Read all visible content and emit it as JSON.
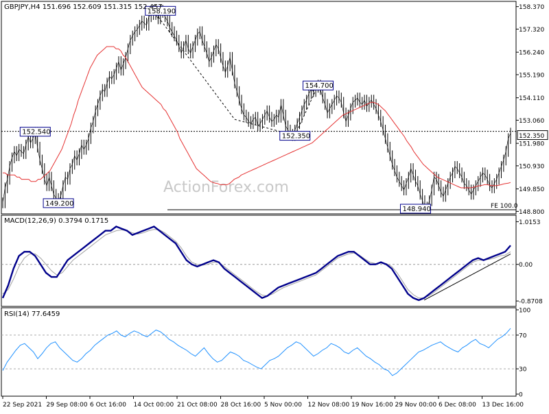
{
  "chart_data": [
    {
      "type": "line",
      "panel": "price",
      "title": "GBPJPY,H4  151.696 152.609 151.315 152.457",
      "watermark": "ActionForex.com",
      "ylim": [
        148.78,
        158.52
      ],
      "yticks": [
        "158.370",
        "157.320",
        "156.240",
        "155.190",
        "154.110",
        "153.060",
        "151.980",
        "150.930",
        "149.850",
        "148.800"
      ],
      "current_price_label": "152.350",
      "horizontal_levels": [
        {
          "name": "resistance-152.54",
          "value": 152.54
        },
        {
          "name": "fe-100",
          "value": 148.94,
          "label": "FE 100.0"
        }
      ],
      "annotations": [
        {
          "text": "158.190",
          "xi": 68,
          "y": 158.19
        },
        {
          "text": "152.540",
          "xi": 14,
          "y": 152.54
        },
        {
          "text": "149.200",
          "xi": 24,
          "y": 149.2
        },
        {
          "text": "154.700",
          "xi": 136,
          "y": 154.7
        },
        {
          "text": "152.350",
          "xi": 126,
          "y": 152.35
        },
        {
          "text": "148.940",
          "xi": 178,
          "y": 148.94
        }
      ],
      "series": [
        {
          "name": "GBPJPY",
          "color": "#000000",
          "values": [
            149.2,
            149.9,
            150.3,
            150.9,
            151.3,
            151.6,
            151.4,
            151.7,
            151.6,
            151.5,
            151.9,
            152.3,
            152.0,
            152.2,
            152.5,
            151.8,
            151.2,
            150.8,
            150.3,
            150.0,
            150.4,
            150.0,
            149.6,
            149.4,
            149.3,
            149.5,
            150.0,
            150.4,
            150.3,
            150.8,
            151.0,
            151.4,
            151.2,
            151.5,
            151.9,
            151.7,
            151.9,
            152.2,
            152.7,
            153.0,
            153.5,
            153.8,
            154.2,
            154.5,
            154.4,
            154.8,
            155.1,
            155.0,
            155.2,
            155.5,
            155.8,
            155.4,
            155.7,
            156.0,
            156.4,
            156.8,
            157.0,
            157.2,
            157.3,
            157.5,
            157.7,
            157.6,
            157.5,
            157.9,
            158.0,
            158.2,
            158.0,
            157.8,
            158.2,
            158.1,
            157.9,
            157.7,
            157.4,
            157.2,
            157.0,
            156.8,
            156.5,
            156.2,
            156.5,
            156.8,
            156.4,
            156.2,
            156.5,
            156.8,
            157.1,
            157.2,
            156.8,
            156.5,
            156.2,
            155.8,
            156.0,
            156.3,
            156.6,
            156.4,
            156.0,
            155.6,
            155.3,
            155.6,
            156.0,
            155.4,
            154.8,
            154.4,
            154.0,
            153.6,
            153.3,
            153.2,
            153.0,
            152.9,
            153.1,
            153.2,
            152.8,
            152.9,
            153.1,
            153.3,
            153.5,
            153.2,
            153.0,
            153.1,
            153.3,
            153.2,
            153.8,
            153.3,
            152.8,
            152.6,
            152.4,
            152.35,
            152.6,
            152.9,
            153.2,
            153.5,
            153.8,
            154.0,
            154.3,
            154.5,
            154.4,
            154.6,
            154.7,
            154.5,
            154.1,
            153.8,
            153.4,
            153.6,
            153.8,
            154.0,
            154.2,
            154.1,
            153.9,
            153.4,
            153.0,
            153.3,
            153.6,
            153.9,
            154.0,
            154.1,
            153.9,
            153.8,
            154.0,
            153.7,
            153.9,
            154.0,
            153.8,
            153.6,
            153.3,
            153.0,
            152.6,
            152.2,
            151.8,
            151.4,
            151.0,
            150.7,
            150.4,
            150.2,
            150.0,
            149.8,
            150.1,
            150.4,
            150.8,
            150.5,
            150.2,
            150.0,
            149.6,
            149.3,
            149.0,
            148.94,
            149.3,
            149.8,
            150.4,
            150.3,
            150.0,
            149.7,
            149.5,
            149.8,
            150.1,
            150.4,
            150.6,
            150.9,
            150.8,
            150.6,
            150.4,
            150.1,
            150.0,
            149.8,
            149.6,
            149.8,
            150.0,
            150.2,
            150.4,
            150.6,
            150.5,
            150.3,
            150.0,
            149.9,
            150.1,
            150.3,
            150.6,
            150.9,
            151.2,
            151.6,
            152.2,
            152.457
          ]
        },
        {
          "name": "MA",
          "color": "#e53030",
          "values": [
            150.6,
            150.6,
            150.5,
            150.5,
            150.5,
            150.5,
            150.4,
            150.4,
            150.3,
            150.3,
            150.3,
            150.3,
            150.2,
            150.2,
            150.2,
            150.3,
            150.3,
            150.4,
            150.5,
            150.6,
            150.7,
            150.9,
            151.1,
            151.3,
            151.5,
            151.7,
            152.0,
            152.3,
            152.6,
            152.9,
            153.3,
            153.6,
            154.0,
            154.3,
            154.6,
            154.9,
            155.2,
            155.5,
            155.7,
            155.9,
            156.1,
            156.2,
            156.3,
            156.4,
            156.5,
            156.5,
            156.5,
            156.5,
            156.4,
            156.4,
            156.3,
            156.1,
            156.0,
            155.8,
            155.6,
            155.4,
            155.2,
            155.0,
            154.8,
            154.6,
            154.5,
            154.4,
            154.3,
            154.2,
            154.1,
            154.0,
            153.9,
            153.8,
            153.6,
            153.5,
            153.3,
            153.1,
            152.9,
            152.7,
            152.5,
            152.2,
            152.0,
            151.8,
            151.6,
            151.4,
            151.2,
            151.0,
            150.8,
            150.7,
            150.6,
            150.5,
            150.4,
            150.3,
            150.2,
            150.15,
            150.12,
            150.1,
            150.05,
            150.05,
            150.05,
            150.05,
            150.1,
            150.2,
            150.3,
            150.35,
            150.4,
            150.5,
            150.55,
            150.6,
            150.65,
            150.7,
            150.75,
            150.8,
            150.85,
            150.9,
            150.95,
            151.0,
            151.05,
            151.1,
            151.15,
            151.2,
            151.25,
            151.3,
            151.35,
            151.4,
            151.45,
            151.5,
            151.55,
            151.6,
            151.65,
            151.7,
            151.75,
            151.8,
            151.85,
            151.9,
            151.95,
            152.0,
            152.1,
            152.2,
            152.3,
            152.4,
            152.5,
            152.6,
            152.7,
            152.8,
            152.9,
            153.0,
            153.1,
            153.2,
            153.3,
            153.35,
            153.4,
            153.45,
            153.5,
            153.55,
            153.6,
            153.65,
            153.7,
            153.75,
            153.8,
            153.85,
            153.9,
            153.9,
            153.85,
            153.8,
            153.7,
            153.6,
            153.5,
            153.35,
            153.2,
            153.05,
            152.9,
            152.75,
            152.6,
            152.45,
            152.3,
            152.1,
            151.95,
            151.8,
            151.6,
            151.45,
            151.3,
            151.15,
            151.0,
            150.9,
            150.8,
            150.7,
            150.6,
            150.5,
            150.4,
            150.35,
            150.3,
            150.25,
            150.2,
            150.15,
            150.1,
            150.05,
            150.0,
            149.95,
            149.9,
            149.9,
            149.9,
            149.9,
            149.9,
            149.92,
            149.95,
            149.98,
            150.0,
            150.02,
            150.05,
            150.05,
            150.03,
            150.0,
            150.0,
            150.0,
            150.02,
            150.05,
            150.08,
            150.1,
            150.12,
            150.15
          ]
        }
      ]
    },
    {
      "type": "line",
      "panel": "macd",
      "title": "MACD(12,26,9) 0.3794 0.1715",
      "ylim": [
        -0.95,
        1.12
      ],
      "yticks": [
        "1.0153",
        "0.00",
        "-0.8708"
      ],
      "series": [
        {
          "name": "MACD",
          "color": "#00008b",
          "values": [
            -0.8,
            -0.5,
            -0.1,
            0.2,
            0.3,
            0.3,
            0.2,
            0.0,
            -0.2,
            -0.3,
            -0.3,
            -0.1,
            0.1,
            0.2,
            0.3,
            0.4,
            0.5,
            0.6,
            0.7,
            0.8,
            0.8,
            0.9,
            0.85,
            0.8,
            0.7,
            0.75,
            0.8,
            0.85,
            0.9,
            0.8,
            0.7,
            0.6,
            0.5,
            0.3,
            0.1,
            0.0,
            -0.05,
            0.0,
            0.05,
            0.1,
            0.05,
            -0.1,
            -0.2,
            -0.3,
            -0.4,
            -0.5,
            -0.6,
            -0.7,
            -0.8,
            -0.75,
            -0.65,
            -0.55,
            -0.5,
            -0.45,
            -0.4,
            -0.35,
            -0.3,
            -0.25,
            -0.2,
            -0.1,
            0.0,
            0.1,
            0.2,
            0.25,
            0.3,
            0.3,
            0.2,
            0.1,
            0.0,
            0.0,
            0.05,
            0.0,
            -0.1,
            -0.3,
            -0.5,
            -0.7,
            -0.8,
            -0.85,
            -0.8,
            -0.7,
            -0.6,
            -0.5,
            -0.4,
            -0.3,
            -0.2,
            -0.1,
            0.0,
            0.1,
            0.15,
            0.1,
            0.15,
            0.2,
            0.25,
            0.3,
            0.45
          ]
        },
        {
          "name": "Signal",
          "color": "#a0a0a0",
          "values": [
            -0.7,
            -0.6,
            -0.35,
            -0.05,
            0.15,
            0.25,
            0.25,
            0.15,
            0.0,
            -0.15,
            -0.25,
            -0.2,
            -0.05,
            0.1,
            0.2,
            0.3,
            0.4,
            0.5,
            0.6,
            0.7,
            0.75,
            0.8,
            0.82,
            0.8,
            0.75,
            0.72,
            0.75,
            0.8,
            0.83,
            0.82,
            0.75,
            0.65,
            0.55,
            0.4,
            0.2,
            0.05,
            0.0,
            -0.02,
            0.0,
            0.05,
            0.05,
            -0.05,
            -0.15,
            -0.25,
            -0.35,
            -0.45,
            -0.55,
            -0.65,
            -0.73,
            -0.75,
            -0.7,
            -0.62,
            -0.55,
            -0.5,
            -0.45,
            -0.4,
            -0.35,
            -0.3,
            -0.25,
            -0.15,
            -0.05,
            0.05,
            0.15,
            0.2,
            0.25,
            0.27,
            0.22,
            0.13,
            0.05,
            0.02,
            0.03,
            0.02,
            -0.05,
            -0.2,
            -0.4,
            -0.6,
            -0.72,
            -0.8,
            -0.8,
            -0.74,
            -0.65,
            -0.55,
            -0.45,
            -0.35,
            -0.25,
            -0.15,
            -0.05,
            0.05,
            0.1,
            0.1,
            0.12,
            0.15,
            0.2,
            0.22,
            0.3
          ]
        }
      ],
      "trendline": {
        "from": [
          78,
          -0.85
        ],
        "to": [
          94,
          0.15
        ]
      }
    },
    {
      "type": "line",
      "panel": "rsi",
      "title": "RSI(14) 77.6459",
      "ylim": [
        0,
        100
      ],
      "yticks": [
        "100",
        "70",
        "30",
        "0"
      ],
      "levels": [
        70,
        30
      ],
      "series": [
        {
          "name": "RSI",
          "color": "#1e90ff",
          "values": [
            28,
            38,
            45,
            52,
            58,
            60,
            55,
            50,
            42,
            48,
            55,
            60,
            62,
            55,
            50,
            45,
            40,
            38,
            42,
            48,
            52,
            58,
            62,
            66,
            70,
            72,
            75,
            70,
            68,
            72,
            75,
            73,
            70,
            68,
            72,
            76,
            74,
            70,
            65,
            62,
            58,
            55,
            52,
            48,
            45,
            50,
            55,
            48,
            42,
            38,
            40,
            45,
            50,
            48,
            45,
            40,
            38,
            35,
            32,
            30,
            35,
            40,
            42,
            45,
            50,
            55,
            58,
            62,
            60,
            55,
            50,
            45,
            48,
            52,
            55,
            60,
            58,
            55,
            50,
            48,
            52,
            55,
            50,
            45,
            42,
            38,
            35,
            30,
            28,
            22,
            25,
            30,
            35,
            40,
            45,
            50,
            52,
            55,
            58,
            60,
            62,
            58,
            55,
            52,
            50,
            55,
            58,
            62,
            65,
            60,
            58,
            55,
            60,
            65,
            68,
            72,
            78
          ]
        }
      ]
    }
  ],
  "xaxis": {
    "labels": [
      "22 Sep 2021",
      "29 Sep 08:00",
      "6 Oct 16:00",
      "14 Oct 00:00",
      "21 Oct 08:00",
      "28 Oct 16:00",
      "5 Nov 00:00",
      "12 Nov 08:00",
      "19 Nov 16:00",
      "29 Nov 00:00",
      "6 Dec 08:00",
      "13 Dec 16:00"
    ]
  }
}
